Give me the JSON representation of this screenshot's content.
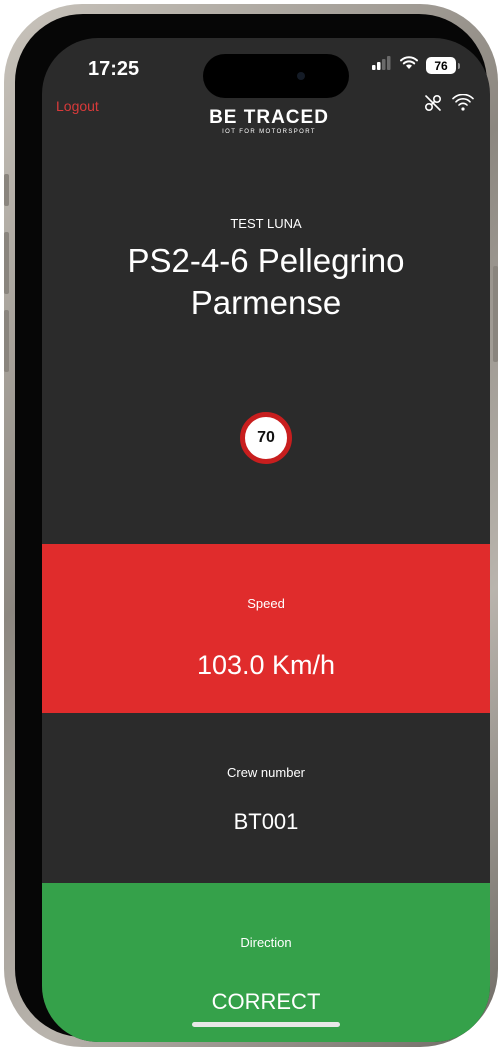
{
  "status_bar": {
    "time": "17:25",
    "battery": "76",
    "icons": [
      "cellular-signal-icon",
      "wifi-icon",
      "battery-icon"
    ]
  },
  "header": {
    "logout_label": "Logout",
    "logo_main": "BE TRACED",
    "logo_sub": "IOT FOR MOTORSPORT",
    "icons": [
      "gps-off-icon",
      "wifi-icon"
    ]
  },
  "stage": {
    "label": "TEST LUNA",
    "title": "PS2-4-6 Pellegrino Parmense"
  },
  "speed_limit": "70",
  "speed": {
    "label": "Speed",
    "value": "103.0 Km/h"
  },
  "crew": {
    "label": "Crew number",
    "value": "BT001"
  },
  "direction": {
    "label": "Direction",
    "value": "CORRECT"
  },
  "colors": {
    "background": "#2b2b2b",
    "speed_alert": "#e02c2c",
    "direction_ok": "#35a14a",
    "logout": "#d83a3a",
    "limit_ring": "#c81e1e"
  }
}
